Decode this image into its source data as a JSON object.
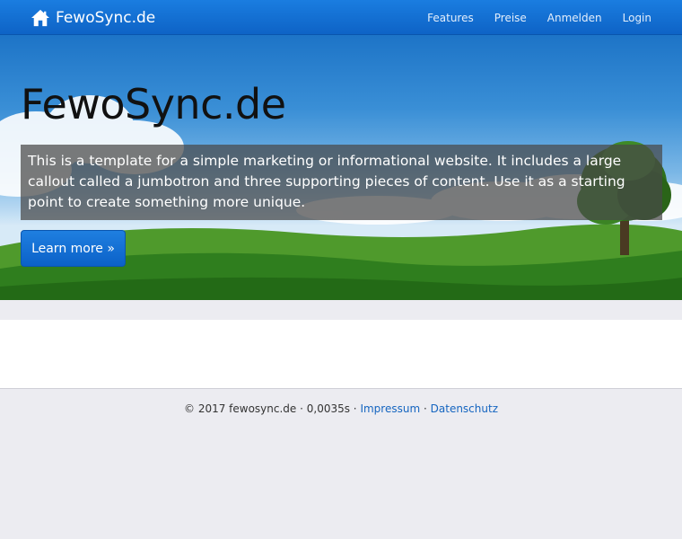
{
  "navbar": {
    "brand": "FewoSync.de",
    "brand_icon": "home-icon",
    "links": [
      "Features",
      "Preise",
      "Anmelden",
      "Login"
    ]
  },
  "hero": {
    "title": "FewoSync.de",
    "text": "This is a template for a simple marketing or informational website. It includes a large callout called a jumbotron and three supporting pieces of content. Use it as a starting point to create something more unique.",
    "button": "Learn more »"
  },
  "footer": {
    "prefix": "© 2017 fewosync.de · 0,0035s ·",
    "impressum": "Impressum",
    "separator": "·",
    "datenschutz": "Datenschutz"
  },
  "colors": {
    "navbar": "#0e63c6",
    "link": "#1565c0",
    "background": "#ececf1"
  }
}
